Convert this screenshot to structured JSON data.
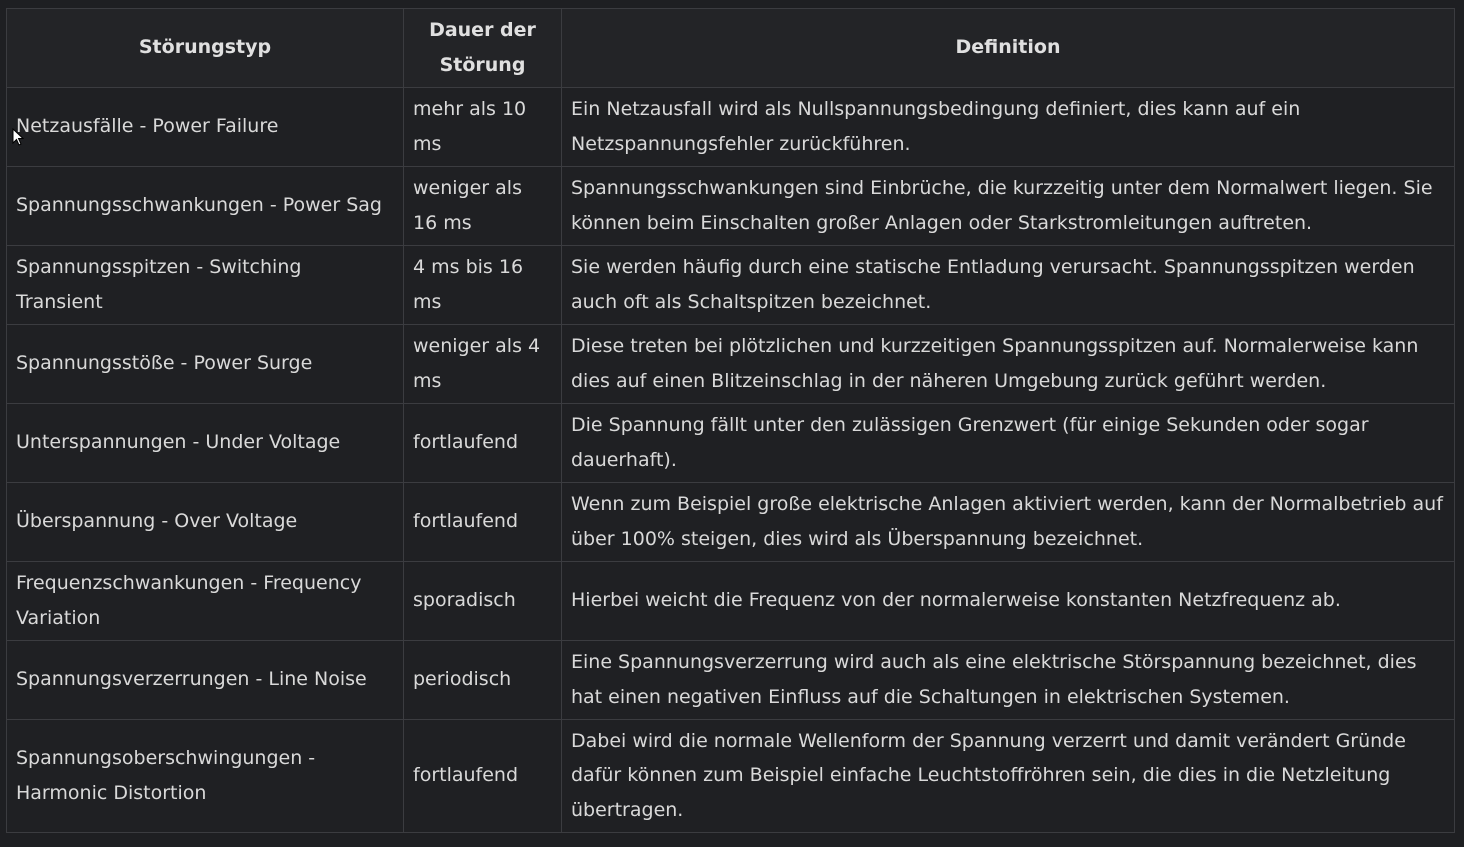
{
  "table": {
    "headers": [
      "Störungstyp",
      "Dauer der Störung",
      "Definition"
    ],
    "rows": [
      {
        "type": "Netzausfälle - Power Failure",
        "duration": "mehr als 10 ms",
        "definition": "Ein Netzausfall wird als Nullspannungsbedingung definiert, dies kann auf ein Netzspannungsfehler zurückführen."
      },
      {
        "type": "Spannungsschwankungen - Power Sag",
        "duration": "weniger als 16 ms",
        "definition": "Spannungsschwankungen sind Einbrüche, die kurzzeitig unter dem Normalwert liegen. Sie können beim Einschalten großer Anlagen oder Starkstromleitungen auftreten."
      },
      {
        "type": "Spannungsspitzen - Switching Transient",
        "duration": "4 ms bis 16 ms",
        "definition": "Sie werden häufig durch eine statische Entladung verursacht. Spannungsspitzen werden auch oft als Schaltspitzen bezeichnet."
      },
      {
        "type": "Spannungsstöße - Power Surge",
        "duration": "weniger als 4 ms",
        "definition": "Diese treten bei plötzlichen und kurzzeitigen Spannungsspitzen auf. Normalerweise kann dies auf einen Blitzeinschlag in der näheren Umgebung zurück geführt werden."
      },
      {
        "type": "Unterspannungen - Under Voltage",
        "duration": "fortlaufend",
        "definition": "Die Spannung fällt unter den zulässigen Grenzwert (für einige Sekunden oder sogar dauerhaft)."
      },
      {
        "type": "Überspannung - Over Voltage",
        "duration": "fortlaufend",
        "definition": "Wenn zum Beispiel große elektrische Anlagen aktiviert werden, kann der Normalbetrieb auf über 100% steigen, dies wird als Überspannung bezeichnet."
      },
      {
        "type": "Frequenzschwankungen - Frequency Variation",
        "duration": "sporadisch",
        "definition": "Hierbei weicht die Frequenz von der normalerweise konstanten Netzfrequenz ab."
      },
      {
        "type": "Spannungsverzerrungen - Line Noise",
        "duration": "periodisch",
        "definition": "Eine Spannungsverzerrung wird auch als eine elektrische Störspannung bezeichnet, dies hat einen negativen Einfluss auf die Schaltungen in elektrischen Systemen."
      },
      {
        "type": "Spannungsoberschwingungen - Harmonic Distortion",
        "duration": "fortlaufend",
        "definition": "Dabei wird die normale Wellenform der Spannung verzerrt und damit verändert Gründe dafür können zum Beispiel einfache Leuchtstoffröhren sein, die dies in die Netzleitung übertragen."
      }
    ]
  },
  "colors": {
    "background": "#1e1f22",
    "border": "#3b3c40",
    "text": "#d9d9d9"
  }
}
